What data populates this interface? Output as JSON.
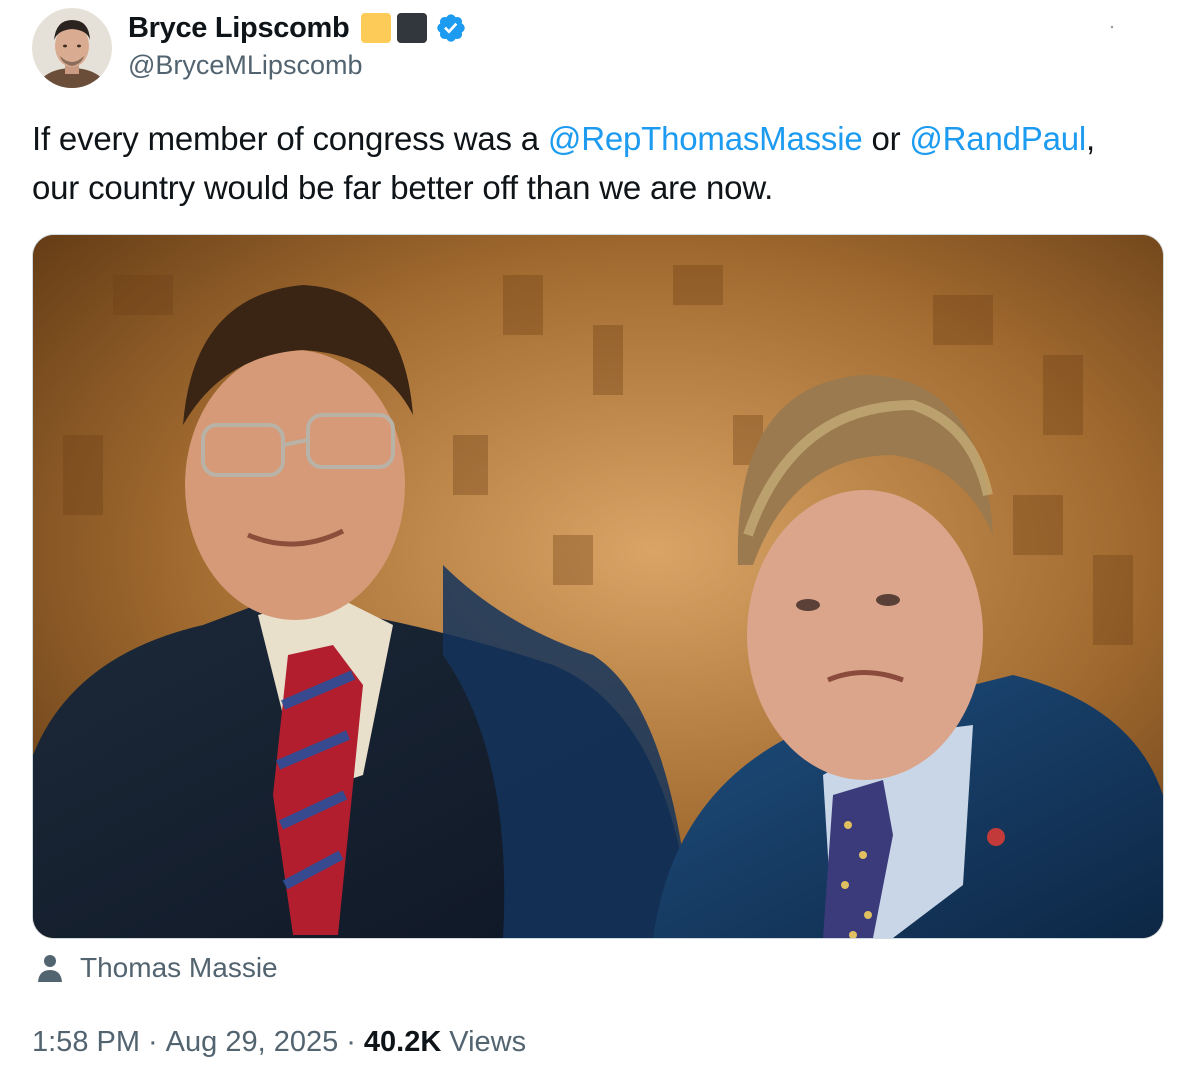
{
  "author": {
    "display_name": "Bryce Lipscomb",
    "handle": "@BryceMLipscomb",
    "badges": [
      {
        "icon": "yellow-square-emoji",
        "color": "#fdcb58"
      },
      {
        "icon": "black-square-emoji",
        "color": "#31373d"
      }
    ],
    "verified_icon": "verified-badge-icon",
    "verified_color": "#1d9bf0"
  },
  "tweet": {
    "text_part1": "If every member of congress was a ",
    "mention1": "@RepThomasMassie",
    "text_part2": " or ",
    "mention2": "@RandPaul",
    "text_part3": ",",
    "text_line2": "our country would be far better off than we are now.",
    "mention_color": "#1d9bf0"
  },
  "media": {
    "type": "photo",
    "tag_icon": "person-icon",
    "tagged_person": "Thomas Massie"
  },
  "meta": {
    "time": "1:58 PM",
    "separator": "·",
    "date": "Aug 29, 2025",
    "views_count": "40.2K",
    "views_label": "Views"
  },
  "colors": {
    "text_primary": "#0f1419",
    "text_secondary": "#536471",
    "link": "#1d9bf0",
    "border": "#cfd9de"
  }
}
